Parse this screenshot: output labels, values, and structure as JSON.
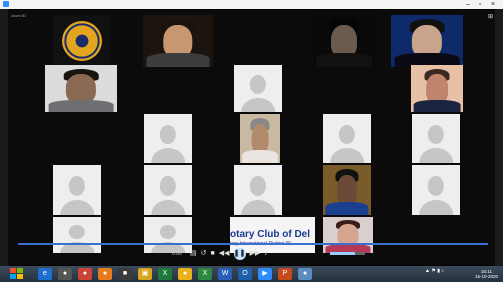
{
  "window": {
    "title": "",
    "meeting_id_label": "zoom ID"
  },
  "icons": {
    "app": "zoom-app-icon",
    "gallery": "gallery-view-icon",
    "minimize": "minimize-icon",
    "maximize": "maximize-icon",
    "close": "close-icon"
  },
  "banner": {
    "text": "otary Club of Del",
    "subtext": "tary International District 30"
  },
  "player": {
    "time_label": "0:00"
  },
  "taskbar": {
    "apps": [
      {
        "name": "internet-explorer-icon",
        "glyph": "e",
        "color": "#1f6fd1"
      },
      {
        "name": "media-player-icon",
        "glyph": "●",
        "color": "#555"
      },
      {
        "name": "chrome-icon",
        "glyph": "●",
        "color": "#c43"
      },
      {
        "name": "firefox-icon",
        "glyph": "●",
        "color": "#e67a1c"
      },
      {
        "name": "app-icon",
        "glyph": "■",
        "color": "#3a3a3a"
      },
      {
        "name": "folder-icon",
        "glyph": "▣",
        "color": "#d8a521"
      },
      {
        "name": "excel-icon",
        "glyph": "X",
        "color": "#1f7a3a"
      },
      {
        "name": "chrome-icon-2",
        "glyph": "●",
        "color": "#e9b21a"
      },
      {
        "name": "excel-icon-2",
        "glyph": "X",
        "color": "#2b8a3e"
      },
      {
        "name": "word-icon",
        "glyph": "W",
        "color": "#2a5fb8"
      },
      {
        "name": "outlook-icon",
        "glyph": "O",
        "color": "#1f5ea8"
      },
      {
        "name": "zoom-taskbar-icon",
        "glyph": "▶",
        "color": "#2d8cff"
      },
      {
        "name": "powerpoint-icon",
        "glyph": "P",
        "color": "#c54a1c"
      },
      {
        "name": "paint-icon",
        "glyph": "●",
        "color": "#5a8cc0"
      }
    ],
    "clock": {
      "time": "16:11",
      "date": "16-10-2020"
    }
  },
  "colors": {
    "taskbar": "#2e3a48",
    "tile_blank": "#141414",
    "avatar_bg": "#eeeeee",
    "progress": "#3a6fd0"
  }
}
